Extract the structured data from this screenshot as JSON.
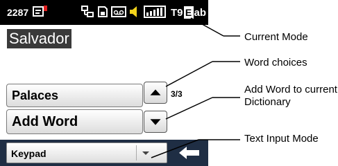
{
  "status_bar": {
    "message_count": "2287",
    "mode_prefix": "T9",
    "mode_case_letter": "E",
    "mode_suffix": "ab"
  },
  "editor": {
    "text": "Salvador"
  },
  "word_choices": {
    "items": [
      "Palaces",
      "Add Word"
    ],
    "page_indicator": "3/3"
  },
  "bottom_bar": {
    "input_mode": "Keypad"
  },
  "callouts": {
    "current_mode": "Current Mode",
    "word_choices": "Word choices",
    "add_word": "Add Word to current Dictionary",
    "text_input_mode": "Text Input Mode"
  },
  "icons": [
    "message-icon",
    "network-icon",
    "memory-card-icon",
    "voicemail-icon",
    "speaker-icon",
    "signal-strength-icon",
    "arrow-up-icon",
    "arrow-down-icon",
    "chevron-down-icon",
    "back-arrow-icon"
  ],
  "colors": {
    "status_bar": "#000000",
    "bottom_bar": "#1f2e44",
    "text_highlight": "#3a3a3a"
  }
}
